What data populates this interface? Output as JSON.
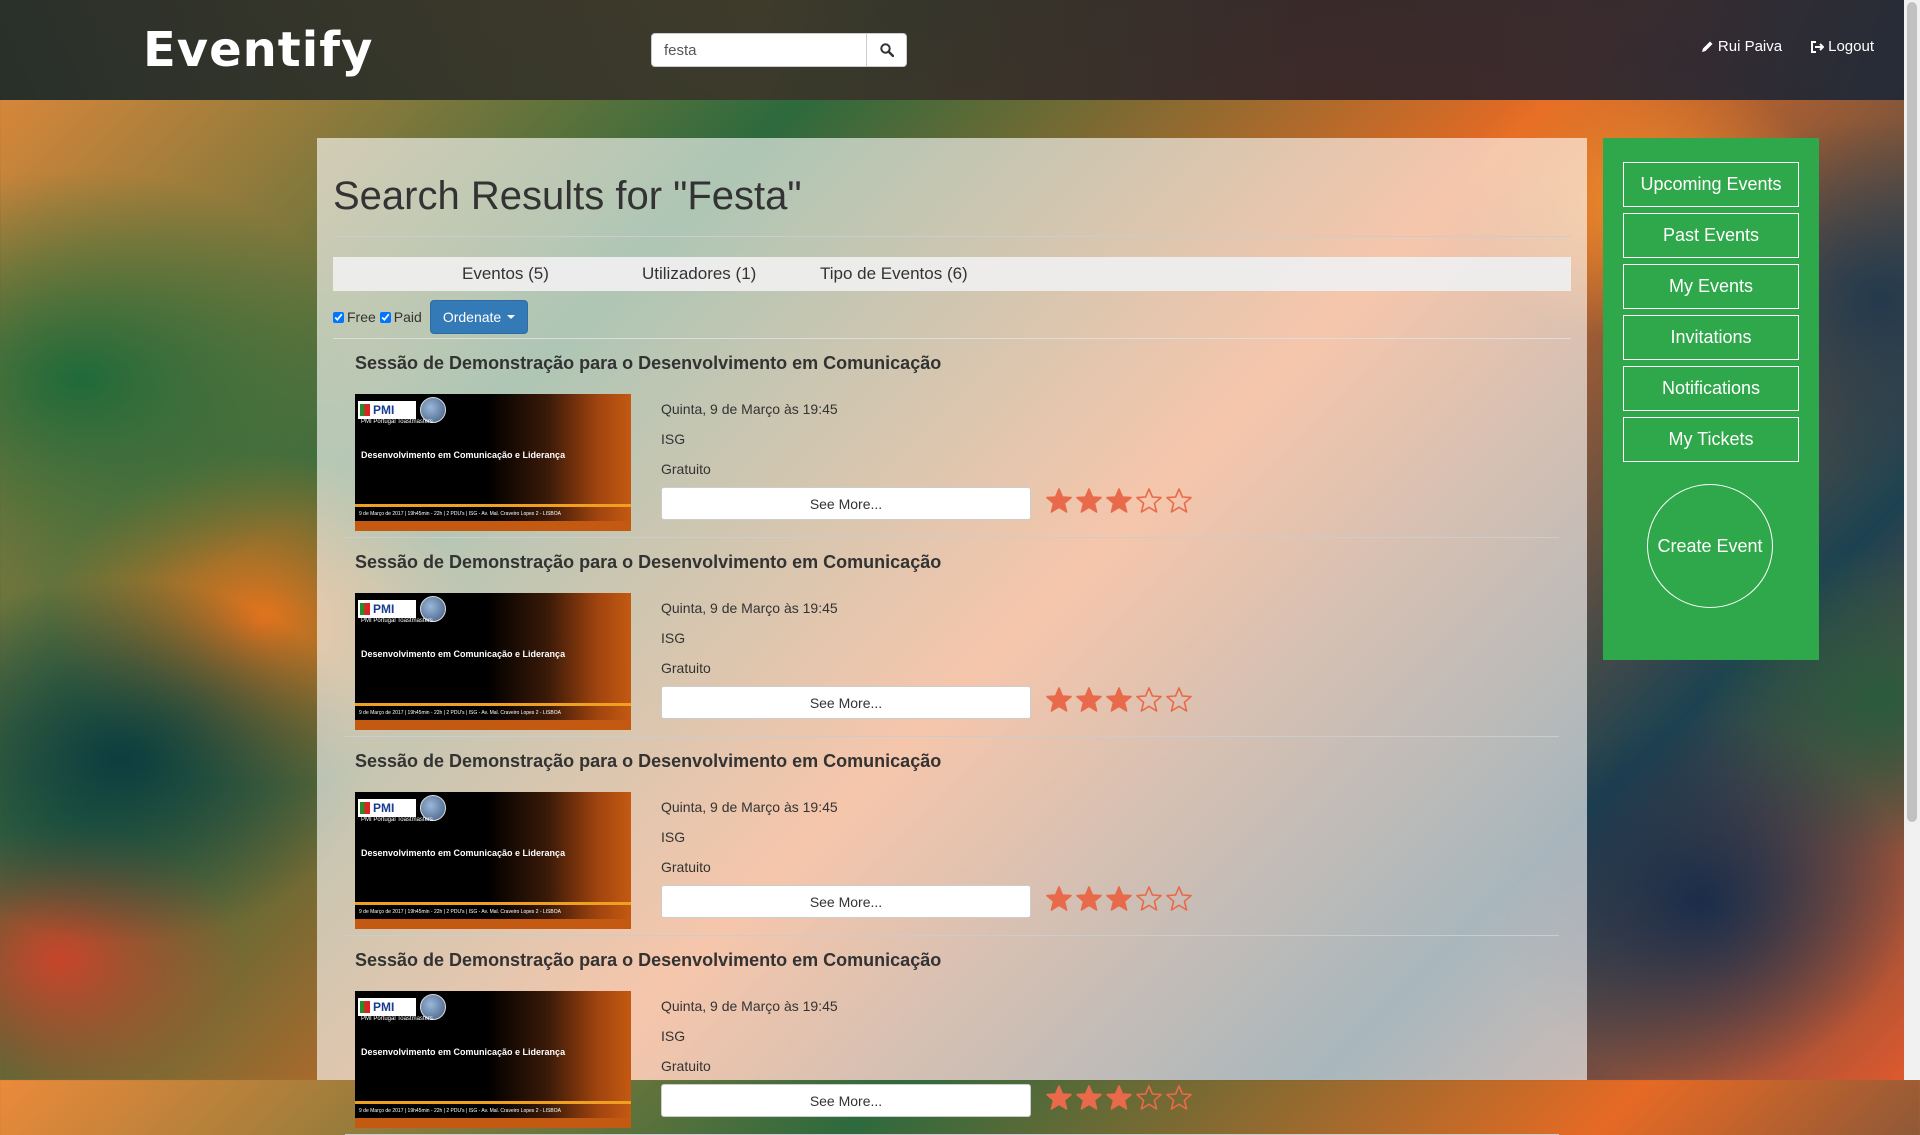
{
  "navbar": {
    "brand": "Eventify",
    "search_value": "festa",
    "user_label": "Rui Paiva",
    "logout_label": "Logout"
  },
  "main": {
    "title": "Search Results for \"Festa\"",
    "tabs": [
      {
        "label": "Eventos (5)"
      },
      {
        "label": "Utilizadores (1)"
      },
      {
        "label": "Tipo de Eventos (6)"
      }
    ],
    "filters": {
      "free_label": "Free",
      "paid_label": "Paid",
      "free_checked": true,
      "paid_checked": true,
      "ordenate_label": "Ordenate"
    },
    "events": [
      {
        "title": "Sessão de Demonstração para o Desenvolvimento em Comunicação",
        "date": "Quinta, 9 de Março às 19:45",
        "location": "ISG",
        "price": "Gratuito",
        "see_more": "See More...",
        "rating": 3,
        "rating_max": 5
      },
      {
        "title": "Sessão de Demonstração para o Desenvolvimento em Comunicação",
        "date": "Quinta, 9 de Março às 19:45",
        "location": "ISG",
        "price": "Gratuito",
        "see_more": "See More...",
        "rating": 3,
        "rating_max": 5
      },
      {
        "title": "Sessão de Demonstração para o Desenvolvimento em Comunicação",
        "date": "Quinta, 9 de Março às 19:45",
        "location": "ISG",
        "price": "Gratuito",
        "see_more": "See More...",
        "rating": 3,
        "rating_max": 5
      },
      {
        "title": "Sessão de Demonstração para o Desenvolvimento em Comunicação",
        "date": "Quinta, 9 de Março às 19:45",
        "location": "ISG",
        "price": "Gratuito",
        "see_more": "See More...",
        "rating": 3,
        "rating_max": 5
      }
    ],
    "thumbnail": {
      "pmi": "PMI",
      "subtitle": "PMI Portugal Toastmasters",
      "headline": "Desenvolvimento em Comunicação e Liderança",
      "info": "9 de Março de 2017 | 19h45min - 22h | 2 PDU's | ISG - Av. Mal. Craveiro Lopes 2 - LISBOA"
    }
  },
  "sidebar": {
    "items": [
      {
        "label": "Upcoming Events"
      },
      {
        "label": "Past Events"
      },
      {
        "label": "My Events"
      },
      {
        "label": "Invitations"
      },
      {
        "label": "Notifications"
      },
      {
        "label": "My Tickets"
      }
    ],
    "create_label": "Create Event"
  },
  "colors": {
    "sidebar_green": "#2ea84a",
    "primary_blue": "#337ab7",
    "star_orange": "#e86a4a"
  },
  "icons": [
    "search-icon",
    "pencil-icon",
    "logout-icon",
    "star-icon",
    "caret-down-icon"
  ]
}
